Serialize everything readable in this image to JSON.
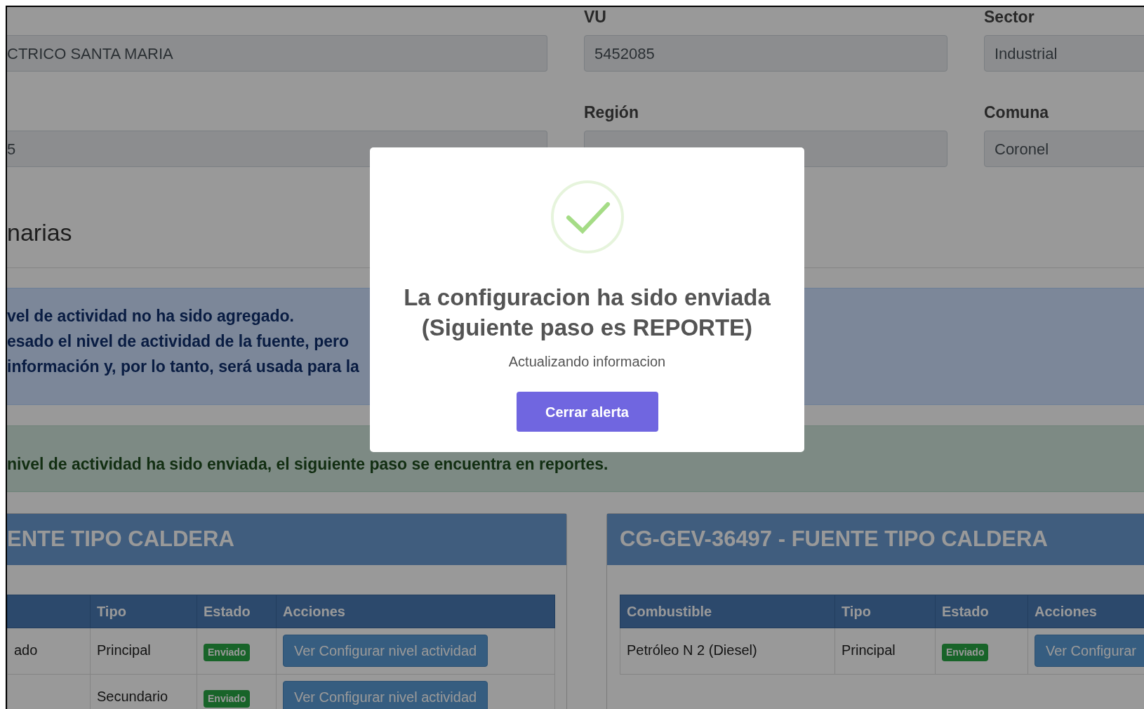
{
  "form_rows": [
    {
      "fields": [
        {
          "value": "CTRICO SANTA MARIA"
        },
        {
          "label": "VU",
          "value": "5452085"
        },
        {
          "label": "Sector",
          "value": "Industrial"
        }
      ]
    },
    {
      "fields": [
        {
          "value": "5"
        },
        {
          "label": "Región"
        },
        {
          "label": "Comuna",
          "value": "Coronel"
        }
      ]
    }
  ],
  "section_title": "narias",
  "info_alert": {
    "lines": [
      "vel de actividad no ha sido agregado.",
      "esado el nivel de actividad de la fuente, pero",
      "información y, por lo tanto, será usada para la"
    ]
  },
  "success_alert": {
    "text": "nivel de actividad ha sido enviada, el siguiente paso se encuentra en reportes."
  },
  "panels": [
    {
      "title": "ENTE TIPO CALDERA",
      "columns": [
        "",
        "Tipo",
        "Estado",
        "Acciones"
      ],
      "rows": [
        {
          "cells": [
            "ado",
            "Principal"
          ],
          "status": "Enviado",
          "action": "Ver Configurar nivel actividad"
        },
        {
          "cells": [
            "",
            "Secundario"
          ],
          "status": "Enviado",
          "action": "Ver Configurar nivel actividad"
        }
      ]
    },
    {
      "title": "CG-GEV-36497 - FUENTE TIPO CALDERA",
      "columns": [
        "Combustible",
        "Tipo",
        "Estado",
        "Acciones"
      ],
      "rows": [
        {
          "cells": [
            "Petróleo N 2 (Diesel)",
            "Principal"
          ],
          "status": "Enviado",
          "action": "Ver Configurar"
        }
      ]
    }
  ],
  "modal": {
    "title_lines": [
      "La configuracion ha sido enviada",
      "(Siguiente paso es REPORTE)"
    ],
    "message": "Actualizando informacion",
    "button": "Cerrar alerta"
  }
}
